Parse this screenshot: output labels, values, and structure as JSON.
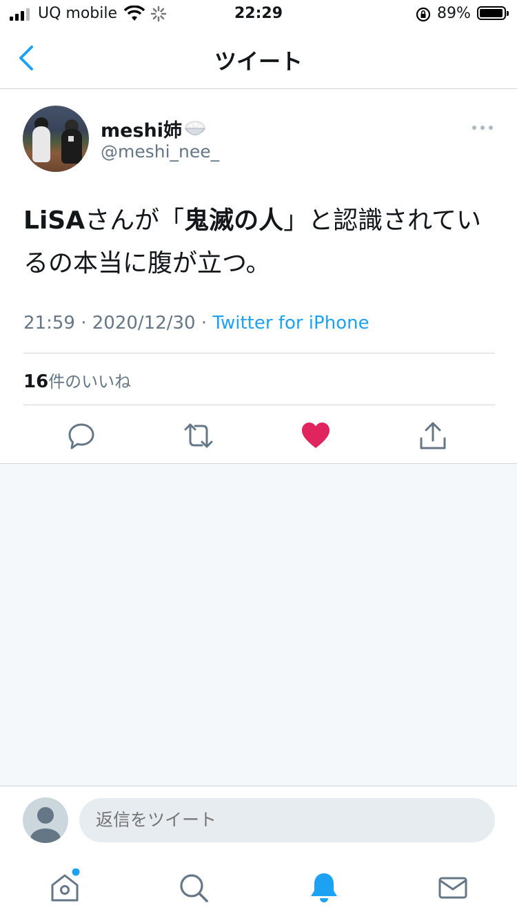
{
  "status": {
    "carrier": "UQ mobile",
    "time": "22:29",
    "battery_pct": "89%"
  },
  "nav": {
    "title": "ツイート"
  },
  "tweet": {
    "display_name": "meshi姉",
    "name_emoji": "rice-bowl-icon",
    "handle": "@meshi_nee_",
    "text_parts": {
      "p1": "LiSA",
      "p2": "さんが「",
      "p3": "鬼滅の人",
      "p4": "」と認識されているの本当に腹が立つ。"
    },
    "meta": {
      "time": "21:59",
      "sep1": "·",
      "date": "2020/12/30",
      "sep2": "·",
      "source": "Twitter for iPhone"
    },
    "likes": {
      "count": "16",
      "label": "件のいいね"
    },
    "liked": true
  },
  "reply": {
    "placeholder": "返信をツイート"
  },
  "colors": {
    "accent": "#1da1f2",
    "like": "#e0245e",
    "secondary": "#657786"
  },
  "tabs": [
    "home-icon",
    "search-icon",
    "notifications-icon",
    "messages-icon"
  ]
}
